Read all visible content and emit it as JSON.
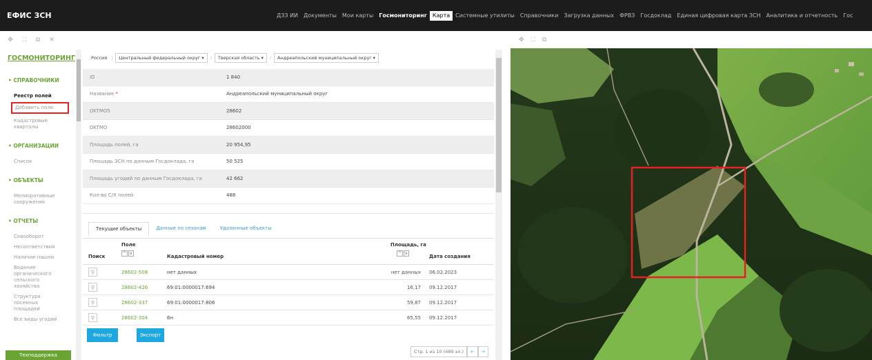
{
  "app": {
    "title": "ЕФИС ЗСН"
  },
  "topnav": [
    {
      "label": "ДЗЗ ИИ",
      "state": ""
    },
    {
      "label": "Документы",
      "state": ""
    },
    {
      "label": "Мои карты",
      "state": ""
    },
    {
      "label": "Госмониторинг",
      "state": "active"
    },
    {
      "label": "Карта",
      "state": "boxed"
    },
    {
      "label": "Системные утилиты",
      "state": ""
    },
    {
      "label": "Справочники",
      "state": ""
    },
    {
      "label": "Загрузка данных",
      "state": ""
    },
    {
      "label": "ФРВЗ",
      "state": ""
    },
    {
      "label": "Госдоклад",
      "state": ""
    },
    {
      "label": "Единая цифровая карта ЗСН",
      "state": ""
    },
    {
      "label": "Аналитика и отчетность",
      "state": ""
    },
    {
      "label": "Гос",
      "state": ""
    }
  ],
  "sidebar": {
    "title": "ГОСМОНИТОРИНГ",
    "sections": {
      "directories": "• СПРАВОЧНИКИ",
      "organizations": "• ОРГАНИЗАЦИИ",
      "objects": "• ОБЪЕКТЫ",
      "reports": "• ОТЧЕТЫ"
    },
    "items": {
      "field_registry": "Реестр полей",
      "add_field": "Добавить поле",
      "cadastral": "Кадастровые кварталы",
      "list": "Список",
      "melioration": "Мелиоративные сооружения",
      "crop_rotation": "Севооборот",
      "mismatches": "Несоответствия",
      "arable": "Наличие пашни",
      "organic": "Ведение органического сельского хозяйства",
      "sown_structure": "Структура посевных площадей",
      "cut": "Все виды угодий"
    },
    "support": "Техподдержка"
  },
  "breadcrumb": {
    "root": "Россия",
    "district": "Центральный федеральный округ ▾",
    "region": "Тверская область ▾",
    "municipality": "Андреапольский муниципальный округ ▾"
  },
  "properties": [
    {
      "key": "ID",
      "value": "1 840"
    },
    {
      "key": "Название",
      "value": "Андреапольский муниципальный округ",
      "required": "*"
    },
    {
      "key": "OKTMO5",
      "value": "28602"
    },
    {
      "key": "OKTMO",
      "value": "28602000"
    },
    {
      "key": "Площадь полей, га",
      "value": "20 954,95"
    },
    {
      "key": "Площадь ЗСН по данным Госдоклада, га",
      "value": "50 525"
    },
    {
      "key": "Площадь угодий по данным Госдоклада, га",
      "value": "42 662"
    },
    {
      "key": "Кол-во С/Х полей",
      "value": "488"
    }
  ],
  "tabs": [
    "Текущие объекты",
    "Данные по сезонам",
    "Удаленные объекты"
  ],
  "table": {
    "headers": {
      "search": "Поиск",
      "field": "Поле",
      "cadastral": "Кадастровый номер",
      "area": "Площадь, га",
      "date": "Дата создания"
    },
    "rows": [
      {
        "field": "28602-508",
        "cadastral": "нет данных",
        "area": "нет данных",
        "date": "06.02.2023"
      },
      {
        "field": "28602-426",
        "cadastral": "69:01:0000017:694",
        "area": "16,17",
        "date": "09.12.2017"
      },
      {
        "field": "28602-337",
        "cadastral": "69:01:0000017:806",
        "area": "59,87",
        "date": "09.12.2017"
      },
      {
        "field": "28602-304",
        "cadastral": "6н",
        "area": "65,55",
        "date": "09.12.2017"
      }
    ]
  },
  "buttons": {
    "filter": "Фильтр",
    "export": "Экспорт"
  },
  "pager": {
    "info": "Стр. 1 из 10 (489 эл.)",
    "prev": "←",
    "next": "→"
  },
  "icons": {
    "move": "✥",
    "expand": "⛶",
    "popout": "⧉",
    "close": "✕",
    "pin": "⚲",
    "sort_up": "^",
    "sort_down": "v"
  },
  "colors": {
    "accent": "#6aa534",
    "link": "#1fa7e0",
    "highlight": "#e52121",
    "topbar": "#1c1c1c"
  }
}
